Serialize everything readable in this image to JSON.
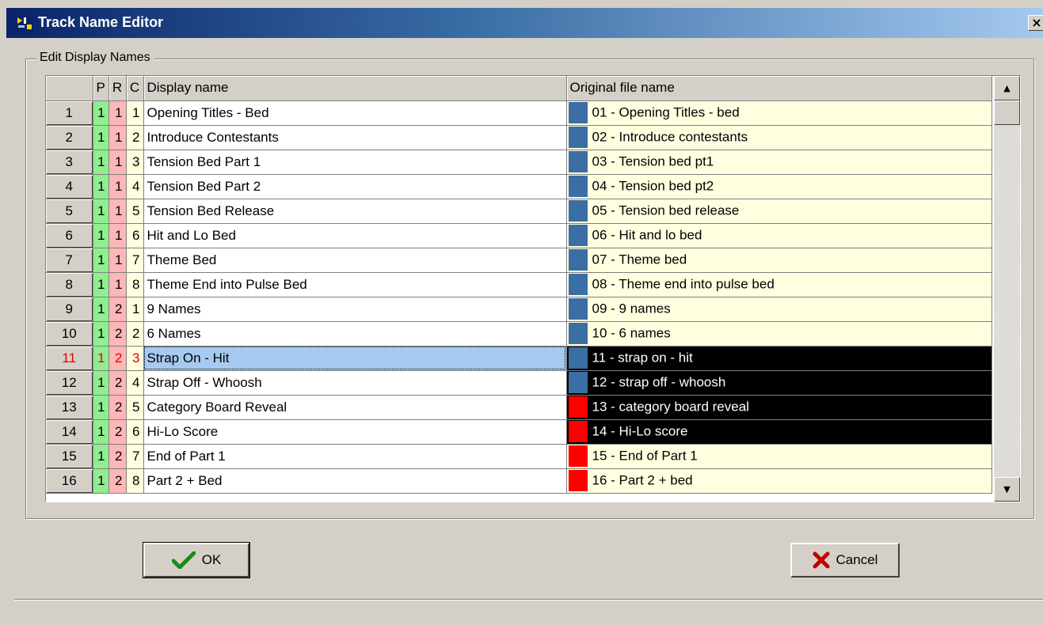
{
  "window": {
    "title": "Track Name Editor",
    "close_label": "×"
  },
  "group": {
    "legend": "Edit Display Names"
  },
  "table": {
    "headers": {
      "rownum": "",
      "p": "P",
      "r": "R",
      "c": "C",
      "display": "Display name",
      "original": "Original file name"
    },
    "rows": [
      {
        "num": "1",
        "p": "1",
        "r": "1",
        "c": "1",
        "display": "Opening Titles - Bed",
        "original": "01 - Opening Titles - bed",
        "swatch": "#3a6ea5",
        "state": "normal"
      },
      {
        "num": "2",
        "p": "1",
        "r": "1",
        "c": "2",
        "display": "Introduce Contestants",
        "original": "02 - Introduce contestants",
        "swatch": "#3a6ea5",
        "state": "normal"
      },
      {
        "num": "3",
        "p": "1",
        "r": "1",
        "c": "3",
        "display": "Tension Bed Part 1",
        "original": "03 - Tension bed pt1",
        "swatch": "#3a6ea5",
        "state": "normal"
      },
      {
        "num": "4",
        "p": "1",
        "r": "1",
        "c": "4",
        "display": "Tension Bed Part 2",
        "original": "04 - Tension bed pt2",
        "swatch": "#3a6ea5",
        "state": "normal"
      },
      {
        "num": "5",
        "p": "1",
        "r": "1",
        "c": "5",
        "display": "Tension Bed Release",
        "original": "05 - Tension bed release",
        "swatch": "#3a6ea5",
        "state": "normal"
      },
      {
        "num": "6",
        "p": "1",
        "r": "1",
        "c": "6",
        "display": "Hit and Lo Bed",
        "original": "06 - Hit and lo bed",
        "swatch": "#3a6ea5",
        "state": "normal"
      },
      {
        "num": "7",
        "p": "1",
        "r": "1",
        "c": "7",
        "display": "Theme Bed",
        "original": "07 - Theme bed",
        "swatch": "#3a6ea5",
        "state": "normal"
      },
      {
        "num": "8",
        "p": "1",
        "r": "1",
        "c": "8",
        "display": "Theme End into Pulse Bed",
        "original": "08 - Theme end into pulse bed",
        "swatch": "#3a6ea5",
        "state": "normal"
      },
      {
        "num": "9",
        "p": "1",
        "r": "2",
        "c": "1",
        "display": "9 Names",
        "original": "09 - 9 names",
        "swatch": "#3a6ea5",
        "state": "normal"
      },
      {
        "num": "10",
        "p": "1",
        "r": "2",
        "c": "2",
        "display": "6 Names",
        "original": "10 - 6 names",
        "swatch": "#3a6ea5",
        "state": "normal"
      },
      {
        "num": "11",
        "p": "1",
        "r": "2",
        "c": "3",
        "display": "Strap On - Hit",
        "original": "11 - strap on - hit",
        "swatch": "#3a6ea5",
        "state": "current"
      },
      {
        "num": "12",
        "p": "1",
        "r": "2",
        "c": "4",
        "display": "Strap Off - Whoosh",
        "original": "12 - strap off - whoosh",
        "swatch": "#3a6ea5",
        "state": "selected"
      },
      {
        "num": "13",
        "p": "1",
        "r": "2",
        "c": "5",
        "display": "Category Board Reveal",
        "original": "13 - category board reveal",
        "swatch": "#ff0000",
        "state": "selected"
      },
      {
        "num": "14",
        "p": "1",
        "r": "2",
        "c": "6",
        "display": "Hi-Lo Score",
        "original": "14 - Hi-Lo score",
        "swatch": "#ff0000",
        "state": "selected"
      },
      {
        "num": "15",
        "p": "1",
        "r": "2",
        "c": "7",
        "display": "End of Part 1",
        "original": "15 - End of Part 1",
        "swatch": "#ff0000",
        "state": "normal"
      },
      {
        "num": "16",
        "p": "1",
        "r": "2",
        "c": "8",
        "display": "Part 2 + Bed",
        "original": "16 - Part 2 + bed",
        "swatch": "#ff0000",
        "state": "normal"
      }
    ]
  },
  "buttons": {
    "ok": "OK",
    "cancel": "Cancel"
  },
  "colors": {
    "p_column": "#90ee90",
    "r_column": "#ffb6b6",
    "c_column": "#ffffe0",
    "selection": "#000000",
    "current_cell": "#a6caf0",
    "current_text": "#e00000"
  },
  "icons": {
    "app": "track-editor-icon",
    "ok": "checkmark-icon",
    "cancel": "x-icon",
    "scroll_up": "arrow-up-icon",
    "scroll_down": "arrow-down-icon"
  }
}
